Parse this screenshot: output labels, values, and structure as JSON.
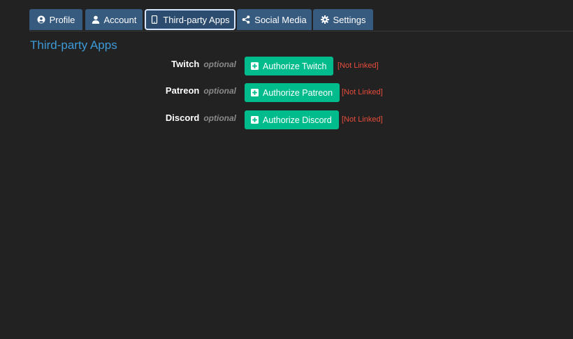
{
  "tabs": [
    {
      "label": "Profile",
      "icon": "user-circle-icon",
      "active": false
    },
    {
      "label": "Account",
      "icon": "user-icon",
      "active": false
    },
    {
      "label": "Third-party Apps",
      "icon": "mobile-icon",
      "active": true
    },
    {
      "label": "Social Media",
      "icon": "share-icon",
      "active": false
    },
    {
      "label": "Settings",
      "icon": "gear-icon",
      "active": false
    }
  ],
  "section": {
    "title": "Third-party Apps"
  },
  "apps": [
    {
      "name": "Twitch",
      "optional": "optional",
      "button_label": "Authorize Twitch",
      "status": "[Not Linked]"
    },
    {
      "name": "Patreon",
      "optional": "optional",
      "button_label": "Authorize Patreon",
      "status": "[Not Linked]"
    },
    {
      "name": "Discord",
      "optional": "optional",
      "button_label": "Authorize Discord",
      "status": "[Not Linked]"
    }
  ],
  "colors": {
    "background": "#222222",
    "tab": "#375a7f",
    "accent_title": "#3d9ad8",
    "button": "#00bc8c",
    "status_error": "#e74c3c"
  }
}
